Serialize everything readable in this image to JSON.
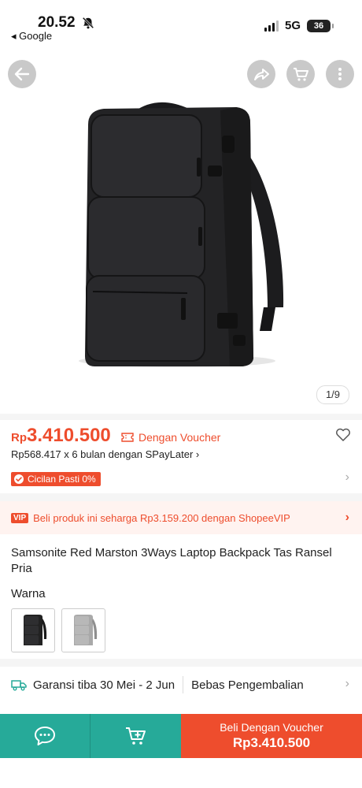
{
  "status_bar": {
    "time": "20.52",
    "back_app": "◂ Google",
    "network": "5G",
    "battery": "36"
  },
  "gallery": {
    "pager": "1/9"
  },
  "price": {
    "currency": "Rp",
    "value": "3.410.500",
    "voucher_label": "Dengan Voucher",
    "installment": "Rp568.417 x 6 bulan dengan SPayLater",
    "installment_chevron": "›",
    "cicilan_label": "Cicilan Pasti 0%"
  },
  "vip": {
    "badge": "VIP",
    "text": "Beli produk ini seharga Rp3.159.200 dengan ShopeeVIP",
    "chevron": "›"
  },
  "product": {
    "title": "Samsonite Red Marston 3Ways Laptop Backpack Tas Ransel Pria",
    "variation_label": "Warna"
  },
  "shipping": {
    "guarantee": "Garansi tiba 30 Mei - 2 Jun",
    "returns": "Bebas Pengembalian"
  },
  "bottom_bar": {
    "buy_line1": "Beli Dengan Voucher",
    "buy_line2": "Rp3.410.500"
  },
  "colors": {
    "brand": "#ee4d2d",
    "teal": "#26aa99"
  }
}
